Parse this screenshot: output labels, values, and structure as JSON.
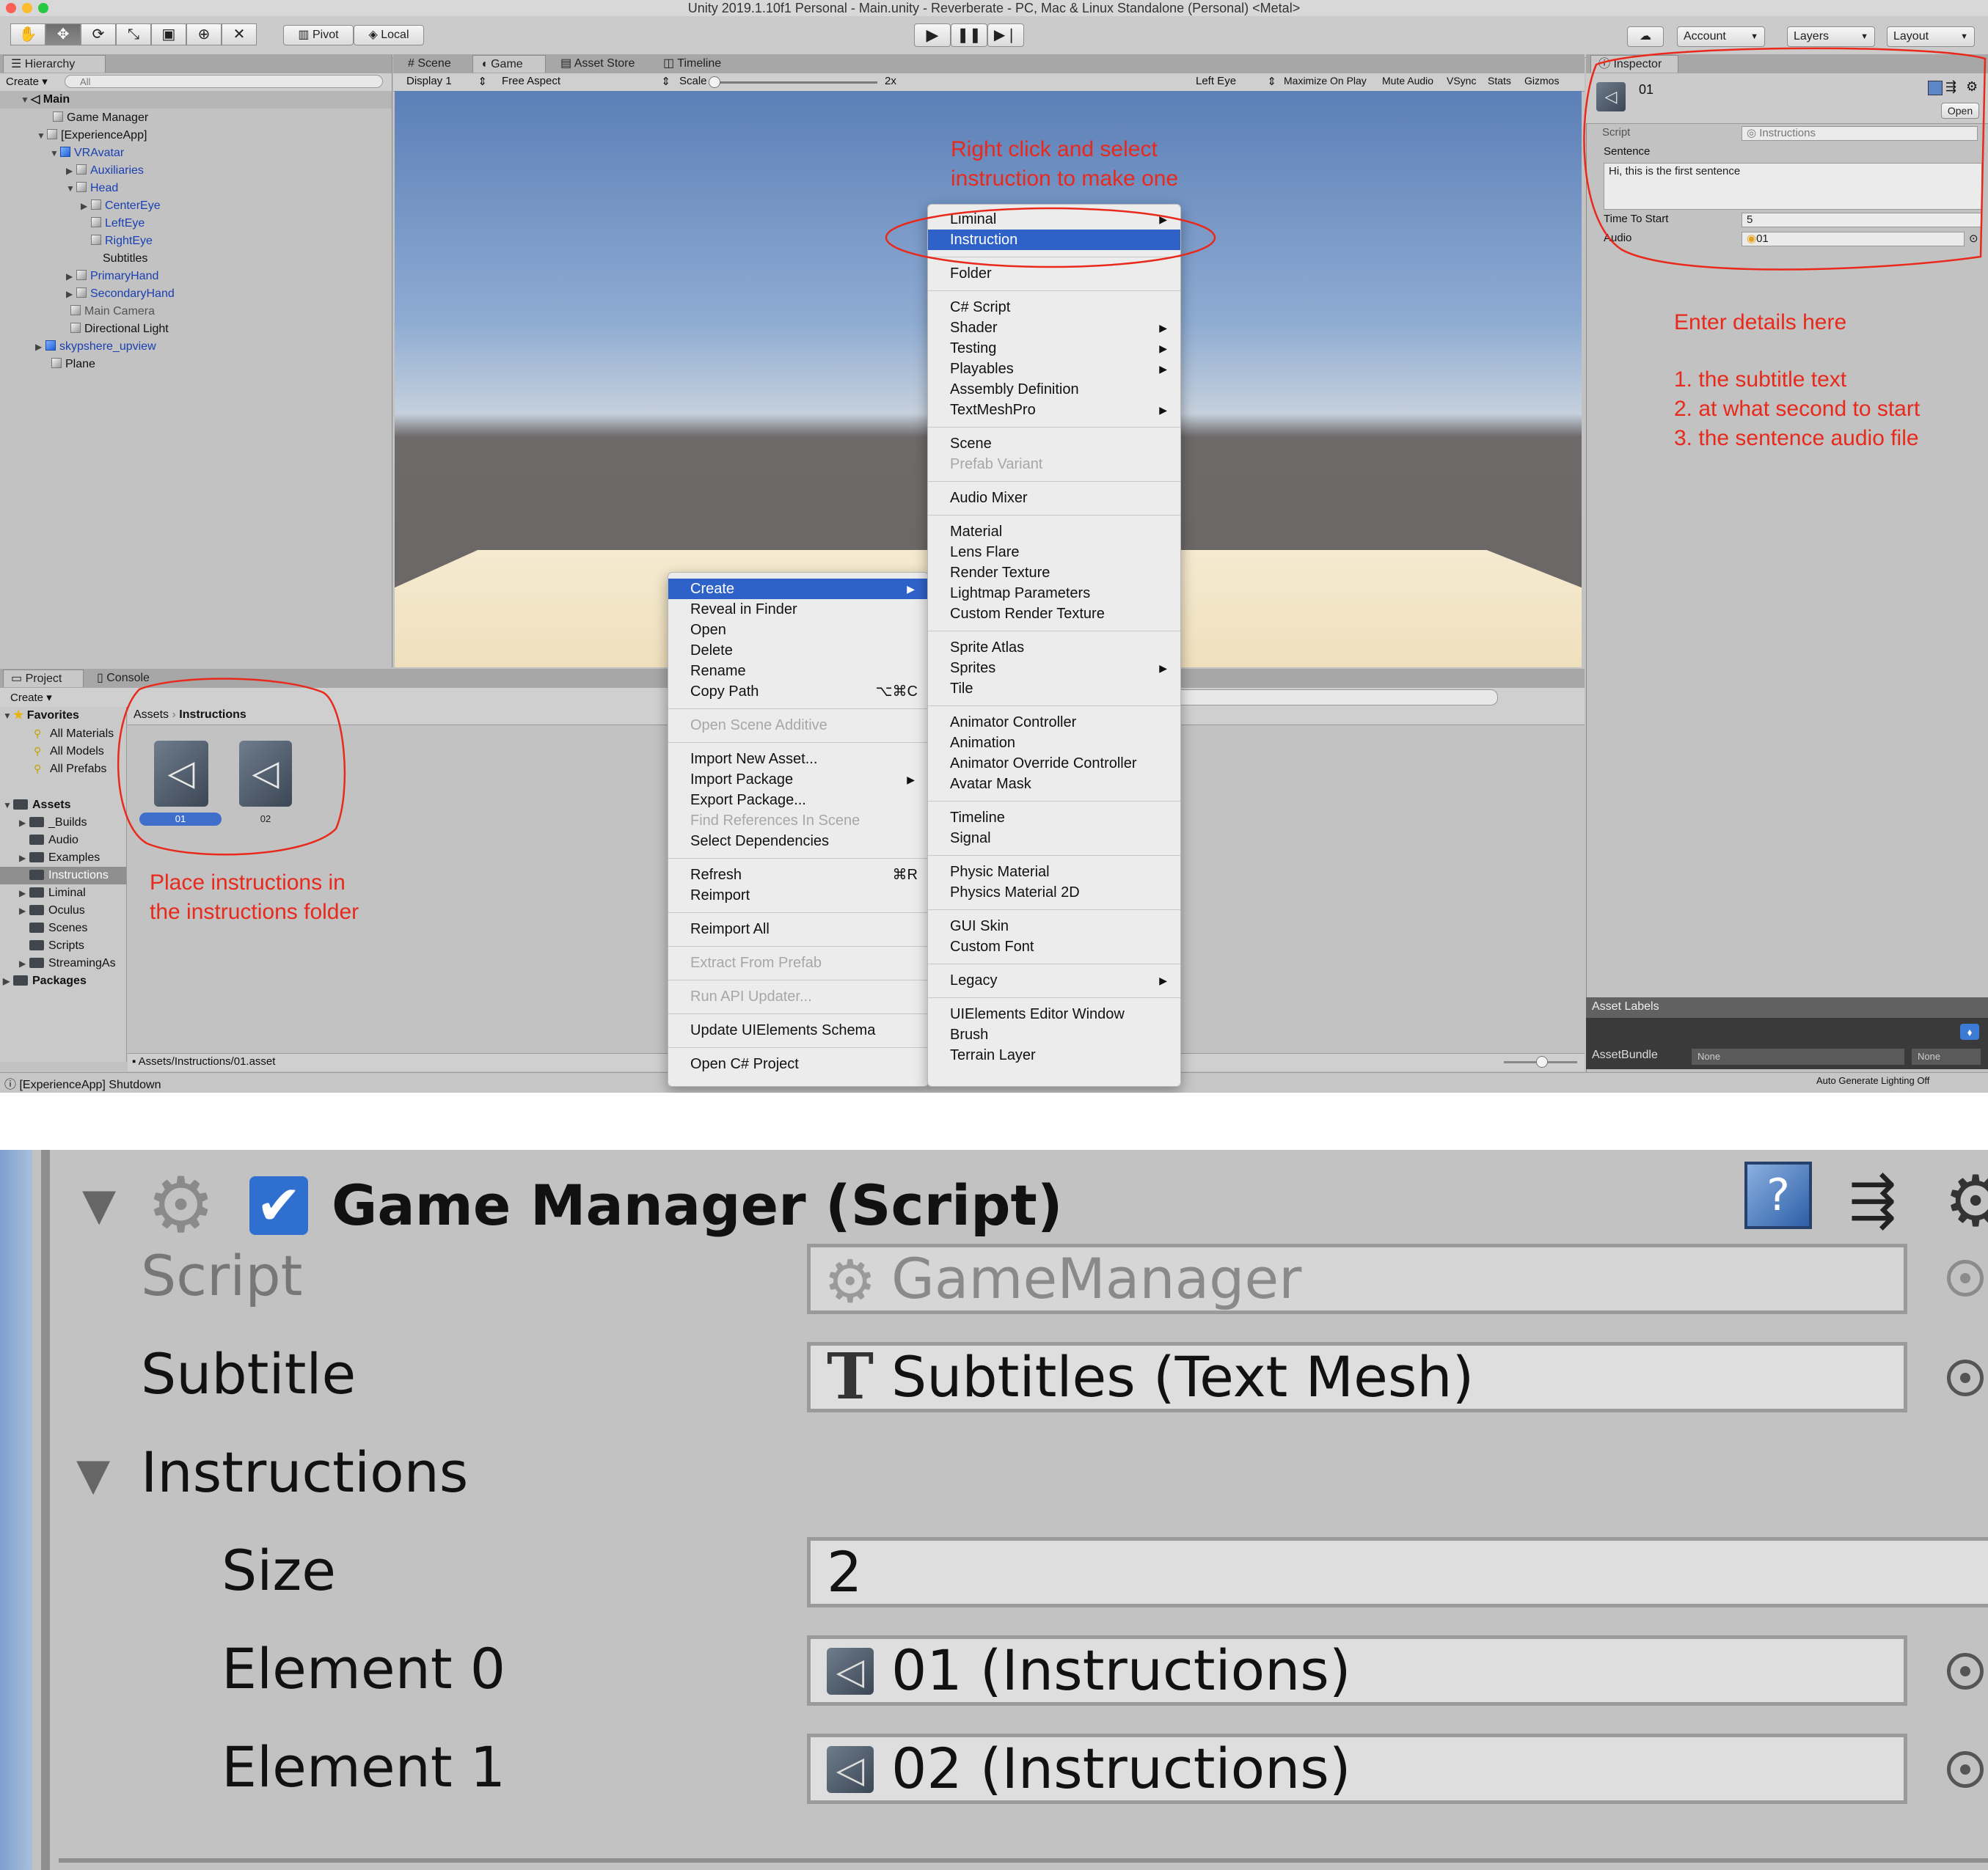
{
  "window": {
    "title": "Unity 2019.1.10f1 Personal - Main.unity - Reverberate - PC, Mac & Linux Standalone (Personal) <Metal>"
  },
  "toolbar": {
    "pivot": "Pivot",
    "local": "Local",
    "account": "Account",
    "layers": "Layers",
    "layout": "Layout"
  },
  "hierarchy": {
    "tab": "Hierarchy",
    "create": "Create",
    "search_placeholder": "All",
    "scene": "Main",
    "items": [
      "Game Manager",
      "[ExperienceApp]",
      "VRAvatar",
      "Auxiliaries",
      "Head",
      "CenterEye",
      "LeftEye",
      "RightEye",
      "Subtitles",
      "PrimaryHand",
      "SecondaryHand",
      "Main Camera",
      "Directional Light",
      "skypshere_upview",
      "Plane"
    ]
  },
  "view_tabs": [
    "Scene",
    "Game",
    "Asset Store",
    "Timeline"
  ],
  "game_bar": {
    "display": "Display 1",
    "aspect": "Free Aspect",
    "scale_label": "Scale",
    "scale_value": "2x",
    "eye": "Left Eye",
    "maximize": "Maximize On Play",
    "mute": "Mute Audio",
    "vsync": "VSync",
    "stats": "Stats",
    "gizmos": "Gizmos"
  },
  "project": {
    "tabs": [
      "Project",
      "Console"
    ],
    "create": "Create",
    "favorites_title": "Favorites",
    "favorites": [
      "All Materials",
      "All Models",
      "All Prefabs"
    ],
    "assets_title": "Assets",
    "folders": [
      "_Builds",
      "Audio",
      "Examples",
      "Instructions",
      "Liminal",
      "Oculus",
      "Scenes",
      "Scripts",
      "StreamingAs"
    ],
    "packages": "Packages",
    "breadcrumb": [
      "Assets",
      "Instructions"
    ],
    "asset_items": [
      "01",
      "02"
    ],
    "path": "Assets/Instructions/01.asset"
  },
  "status": {
    "text": "[ExperienceApp] Shutdown",
    "lighting": "Auto Generate Lighting Off"
  },
  "context_menu": {
    "items": [
      {
        "label": "Create",
        "arrow": true,
        "highlight": true
      },
      {
        "label": "Reveal in Finder"
      },
      {
        "label": "Open"
      },
      {
        "label": "Delete"
      },
      {
        "label": "Rename"
      },
      {
        "label": "Copy Path",
        "shortcut": "⌥⌘C"
      },
      {
        "label": "Open Scene Additive",
        "disabled": true
      },
      {
        "label": "Import New Asset..."
      },
      {
        "label": "Import Package",
        "arrow": true
      },
      {
        "label": "Export Package..."
      },
      {
        "label": "Find References In Scene",
        "disabled": true
      },
      {
        "label": "Select Dependencies"
      },
      {
        "label": "Refresh",
        "shortcut": "⌘R"
      },
      {
        "label": "Reimport"
      },
      {
        "label": "Reimport All"
      },
      {
        "label": "Extract From Prefab",
        "disabled": true
      },
      {
        "label": "Run API Updater...",
        "disabled": true
      },
      {
        "label": "Update UIElements Schema"
      },
      {
        "label": "Open C# Project"
      }
    ]
  },
  "create_menu": {
    "items": [
      {
        "label": "Liminal",
        "arrow": true
      },
      {
        "label": "Instruction",
        "highlight": true
      },
      {
        "label": "Folder"
      },
      {
        "label": "C# Script"
      },
      {
        "label": "Shader",
        "arrow": true
      },
      {
        "label": "Testing",
        "arrow": true
      },
      {
        "label": "Playables",
        "arrow": true
      },
      {
        "label": "Assembly Definition"
      },
      {
        "label": "TextMeshPro",
        "arrow": true
      },
      {
        "label": "Scene"
      },
      {
        "label": "Prefab Variant",
        "disabled": true
      },
      {
        "label": "Audio Mixer"
      },
      {
        "label": "Material"
      },
      {
        "label": "Lens Flare"
      },
      {
        "label": "Render Texture"
      },
      {
        "label": "Lightmap Parameters"
      },
      {
        "label": "Custom Render Texture"
      },
      {
        "label": "Sprite Atlas"
      },
      {
        "label": "Sprites",
        "arrow": true
      },
      {
        "label": "Tile"
      },
      {
        "label": "Animator Controller"
      },
      {
        "label": "Animation"
      },
      {
        "label": "Animator Override Controller"
      },
      {
        "label": "Avatar Mask"
      },
      {
        "label": "Timeline"
      },
      {
        "label": "Signal"
      },
      {
        "label": "Physic Material"
      },
      {
        "label": "Physics Material 2D"
      },
      {
        "label": "GUI Skin"
      },
      {
        "label": "Custom Font"
      },
      {
        "label": "Legacy",
        "arrow": true
      },
      {
        "label": "UIElements Editor Window"
      },
      {
        "label": "Brush"
      },
      {
        "label": "Terrain Layer"
      }
    ]
  },
  "inspector": {
    "tab": "Inspector",
    "asset_name": "01",
    "open": "Open",
    "script_label": "Script",
    "script_value": "Instructions",
    "sentence_label": "Sentence",
    "sentence_value": "Hi, this is the first sentence",
    "time_label": "Time To Start",
    "time_value": "5",
    "audio_label": "Audio",
    "audio_value": "01",
    "asset_labels": "Asset Labels",
    "assetbundle": "AssetBundle",
    "none1": "None",
    "none2": "None"
  },
  "annotations": {
    "right_click": [
      "Right click and select",
      "instruction to make one"
    ],
    "enter_details": "Enter details here",
    "steps": [
      "1. the subtitle text",
      "2. at what second to start",
      "3. the sentence audio file"
    ],
    "place": [
      "Place instructions in",
      "the instructions folder"
    ]
  },
  "zoom_inspector": {
    "component": "Game Manager (Script)",
    "script_label": "Script",
    "script_value": "GameManager",
    "subtitle_label": "Subtitle",
    "subtitle_value": "Subtitles (Text Mesh)",
    "instructions_label": "Instructions",
    "size_label": "Size",
    "size_value": "2",
    "element0_label": "Element 0",
    "element0_value": "01 (Instructions)",
    "element1_label": "Element 1",
    "element1_value": "02 (Instructions)"
  },
  "colors": {
    "annotation": "#e8291c",
    "selection": "#2f62c9",
    "hierarchy_link": "#1a3fb0"
  }
}
